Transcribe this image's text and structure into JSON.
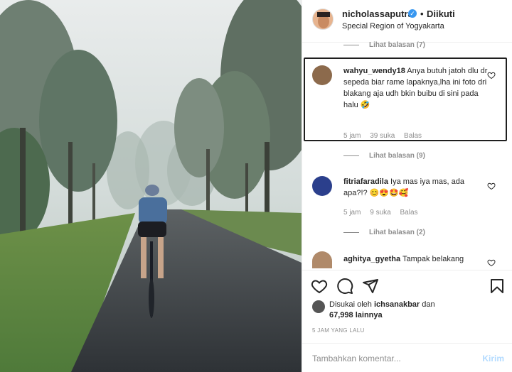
{
  "post": {
    "username": "nicholassaputra",
    "separator": "•",
    "follow_status": "Diikuti",
    "location": "Special Region of Yogyakarta"
  },
  "threads": [
    {
      "replies_label": "Lihat balasan (7)"
    }
  ],
  "comments": [
    {
      "user": "wahyu_wendy18",
      "text": "Anya butuh jatoh dlu dr sepeda biar rame lapaknya,lha ini foto dri blakang aja udh bkin buibu di sini pada halu 🤣",
      "time": "5 jam",
      "likes": "39 suka",
      "reply": "Balas",
      "replies_label": "Lihat balasan (9)"
    },
    {
      "user": "fitriafaradila",
      "text": "Iya mas iya mas, ada apa?!? 😊😍🤩🥰",
      "time": "5 jam",
      "likes": "9 suka",
      "reply": "Balas",
      "replies_label": "Lihat balasan (2)"
    },
    {
      "user": "aghitya_gyetha",
      "text": "Tampak belakang"
    }
  ],
  "liked_by": {
    "prefix": "Disukai oleh",
    "user": "ichsanakbar",
    "and": "dan",
    "count": "67,998",
    "others": "lainnya"
  },
  "time_ago": "5 JAM YANG LALU",
  "composer": {
    "placeholder": "Tambahkan komentar...",
    "post_label": "Kirim"
  },
  "colors": {
    "verified": "#3897f0",
    "muted": "#8e8e8e",
    "post_disabled": "#b3dbff"
  }
}
